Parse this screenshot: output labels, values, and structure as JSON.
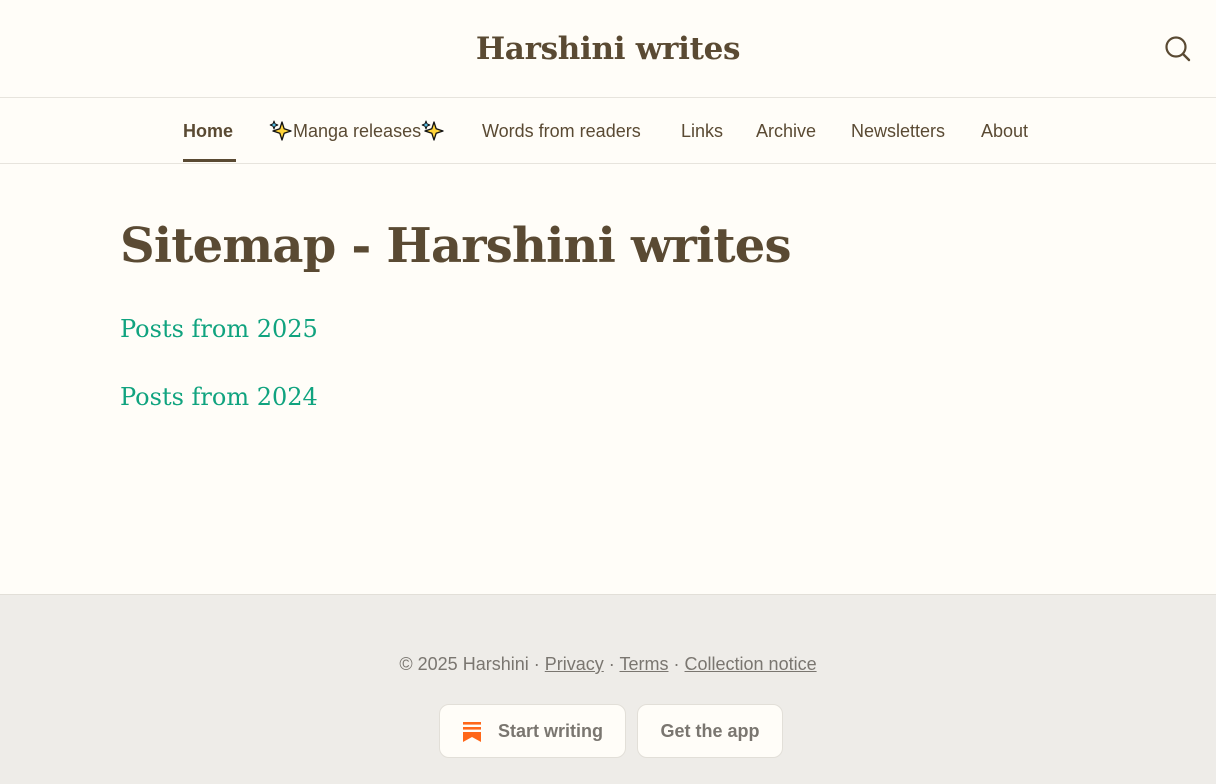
{
  "header": {
    "site_title": "Harshini writes",
    "search_icon": "search-icon"
  },
  "nav": {
    "items": [
      {
        "label": "Home",
        "active": true
      },
      {
        "label": "Manga releases",
        "icon": "sparkles-icon"
      },
      {
        "label": "Words from readers"
      },
      {
        "label": "Links"
      },
      {
        "label": "Archive"
      },
      {
        "label": "Newsletters"
      },
      {
        "label": "About"
      }
    ]
  },
  "main": {
    "title": "Sitemap - Harshini writes",
    "links": [
      {
        "label": "Posts from 2025"
      },
      {
        "label": "Posts from 2024"
      }
    ]
  },
  "footer": {
    "copyright": "© 2025 Harshini",
    "separator": "·",
    "links": [
      {
        "label": "Privacy"
      },
      {
        "label": "Terms"
      },
      {
        "label": "Collection notice"
      }
    ],
    "buttons": {
      "start_writing": "Start writing",
      "get_app": "Get the app"
    }
  },
  "colors": {
    "background": "#fffdf8",
    "brand_text": "#5a4a33",
    "link_green": "#10a37f",
    "footer_bg": "#eeece8",
    "substack_orange": "#ff6719"
  }
}
